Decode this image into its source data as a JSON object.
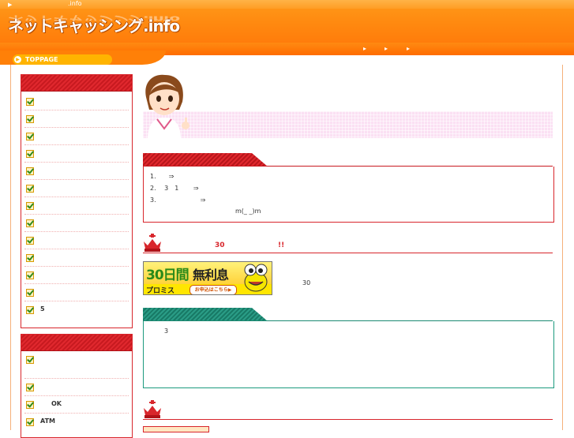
{
  "header": {
    "top_small": ".info",
    "site_logo": "ネットキャッシング.info",
    "nav_arrows": [
      "▸",
      "▸",
      "▸"
    ]
  },
  "toppage": {
    "label": "TOPPAGE"
  },
  "sidebar": {
    "box1_items": [
      "",
      "",
      "",
      "",
      "",
      "",
      "",
      "",
      "",
      "",
      "",
      "",
      "5"
    ],
    "box2_items": [
      "",
      "",
      "OK",
      "ATM"
    ]
  },
  "main": {
    "section1": {
      "lines": [
        "1.　　⇒",
        "2.　 3　1　　 ⇒",
        "3.　　　　　　　⇒",
        "m(_ _)m"
      ]
    },
    "ranking1": {
      "num": "30",
      "exclaim": "!!"
    },
    "ad": {
      "big_text": "30日間",
      "big_text2": "無利息",
      "brand": "プロミス",
      "button": "お申込はこちら▶"
    },
    "ad_side_text": "30",
    "section2": {
      "line": "3"
    }
  },
  "colors": {
    "header_orange": "#ff8a10",
    "accent_red": "#d8262c",
    "accent_green": "#1c9a7e",
    "banner_pink": "#fbe0f3"
  }
}
